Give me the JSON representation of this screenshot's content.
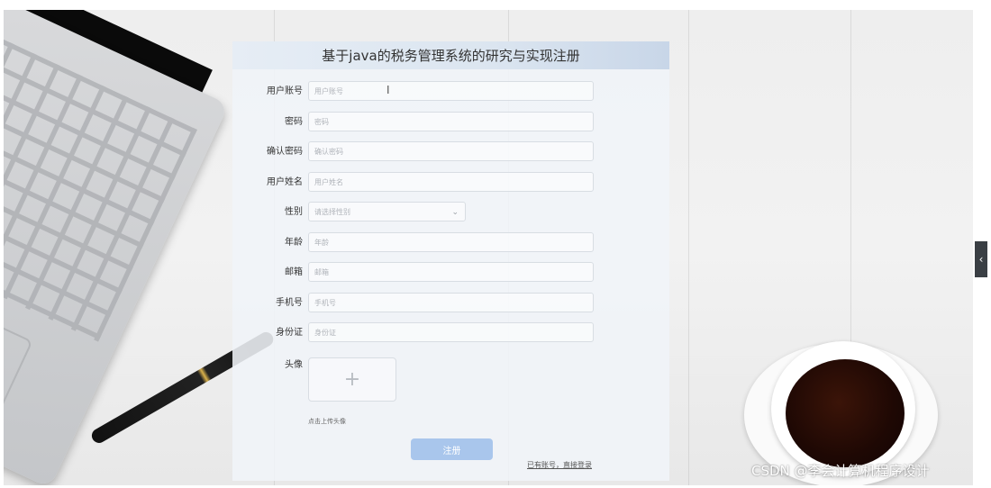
{
  "form": {
    "title": "基于java的税务管理系统的研究与实现注册",
    "fields": [
      {
        "label": "用户账号",
        "placeholder": "用户账号"
      },
      {
        "label": "密码",
        "placeholder": "密码"
      },
      {
        "label": "确认密码",
        "placeholder": "确认密码"
      },
      {
        "label": "用户姓名",
        "placeholder": "用户姓名"
      },
      {
        "label": "性别",
        "placeholder": "请选择性别"
      },
      {
        "label": "年龄",
        "placeholder": "年龄"
      },
      {
        "label": "邮箱",
        "placeholder": "邮箱"
      },
      {
        "label": "手机号",
        "placeholder": "手机号"
      },
      {
        "label": "身份证",
        "placeholder": "身份证"
      }
    ],
    "avatar_label": "头像",
    "avatar_icon": "plus-icon",
    "avatar_plus": "+",
    "avatar_hint": "点击上传头像",
    "submit_label": "注册",
    "login_link": "已有账号，直接登录"
  },
  "side_tab": {
    "icon": "chevron-left-icon",
    "glyph": "‹"
  },
  "watermark": "CSDN @李会计算机程序设计"
}
